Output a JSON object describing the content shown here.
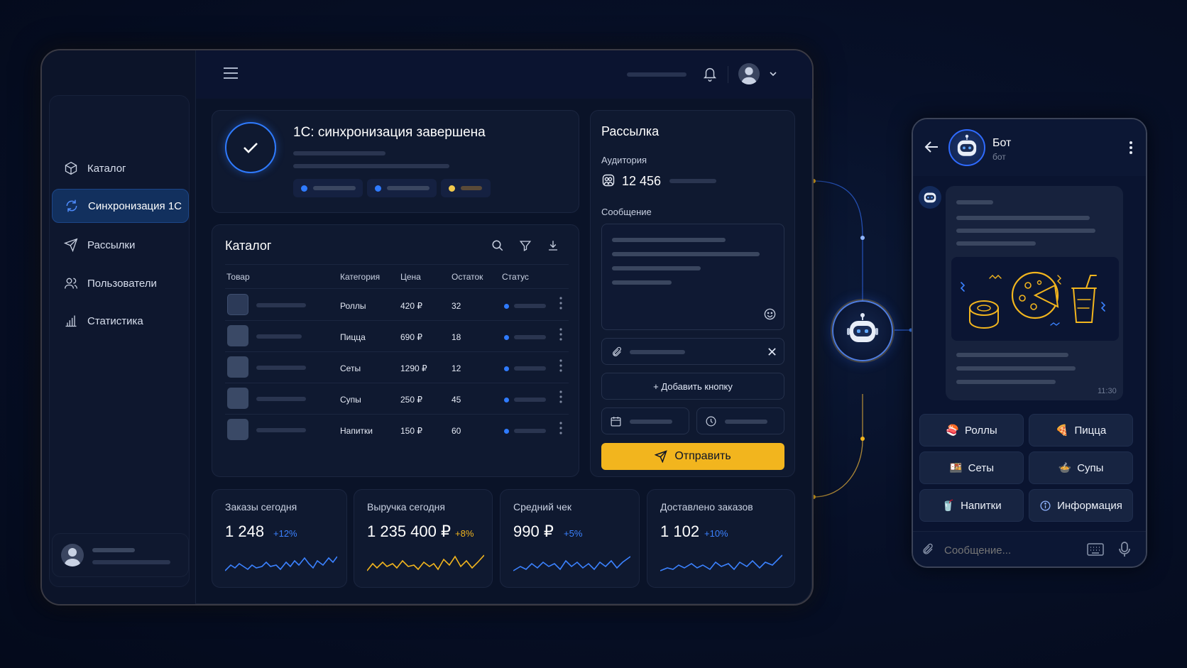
{
  "sidebar": {
    "items": [
      {
        "label": "Каталог",
        "icon": "box-icon",
        "active": false
      },
      {
        "label": "Синхронизация 1С",
        "icon": "sync-icon",
        "active": true
      },
      {
        "label": "Рассылки",
        "icon": "send-icon",
        "active": false
      },
      {
        "label": "Пользователи",
        "icon": "users-icon",
        "active": false
      },
      {
        "label": "Статистика",
        "icon": "chart-icon",
        "active": false
      }
    ]
  },
  "sync": {
    "title": "1С: синхронизация завершена"
  },
  "catalog": {
    "title": "Каталог",
    "columns": [
      "Товар",
      "Категория",
      "Цена",
      "Остаток",
      "Статус"
    ],
    "rows": [
      {
        "category": "Роллы",
        "price": "420 ₽",
        "stock": "32"
      },
      {
        "category": "Пицца",
        "price": "690 ₽",
        "stock": "18"
      },
      {
        "category": "Сеты",
        "price": "1290 ₽",
        "stock": "12"
      },
      {
        "category": "Супы",
        "price": "250 ₽",
        "stock": "45"
      },
      {
        "category": "Напитки",
        "price": "150 ₽",
        "stock": "60"
      }
    ]
  },
  "mailing": {
    "title": "Рассылка",
    "audience_label": "Аудитория",
    "audience_count": "12 456",
    "message_label": "Сообщение",
    "add_button_label": "+ Добавить кнопку",
    "send_label": "Отправить"
  },
  "stats": [
    {
      "label": "Заказы сегодня",
      "value": "1 248",
      "delta": "+12%",
      "color": "#3b82ff"
    },
    {
      "label": "Выручка сегодня",
      "value": "1 235 400 ₽",
      "delta": "+8%",
      "color": "#f2b51e"
    },
    {
      "label": "Средний чек",
      "value": "990 ₽",
      "delta": "+5%",
      "color": "#3b82ff"
    },
    {
      "label": "Доставлено заказов",
      "value": "1 102",
      "delta": "+10%",
      "color": "#3b82ff"
    }
  ],
  "bot": {
    "name": "Бот",
    "subtitle": "бот",
    "message_time": "11:30",
    "buttons": [
      {
        "label": "Роллы",
        "emoji": "🍣"
      },
      {
        "label": "Пицца",
        "emoji": "🍕"
      },
      {
        "label": "Сеты",
        "emoji": "🍱"
      },
      {
        "label": "Супы",
        "emoji": "🍲"
      },
      {
        "label": "Напитки",
        "emoji": "🥤"
      },
      {
        "label": "Информация",
        "icon": "info-icon"
      }
    ],
    "input_placeholder": "Сообщение..."
  },
  "colors": {
    "accent_blue": "#2f7bff",
    "accent_yellow": "#f2b51e",
    "active_nav": "#12305e"
  }
}
